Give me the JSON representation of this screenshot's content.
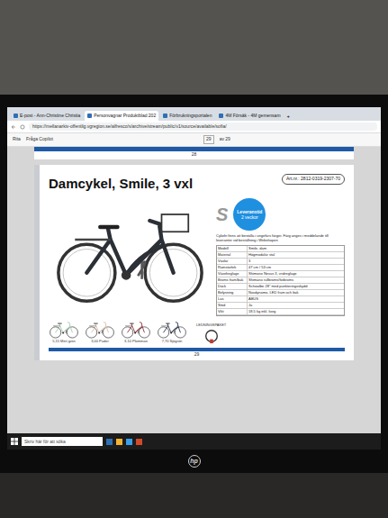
{
  "browser": {
    "tabs": [
      {
        "label": "E-post - Ann-Christine Christia",
        "selected": false
      },
      {
        "label": "Personvagnar Produktblad 202",
        "selected": true
      },
      {
        "label": "Förbrukningsportalen",
        "selected": false
      },
      {
        "label": "4M Försäk - 4M gemensam",
        "selected": false
      }
    ],
    "new_tab": "+",
    "address": "https://mellanarkiv-offentlig.vgregion.se/alfresco/s/archive/stream/public/v1/source/available/sofia/"
  },
  "pdf_toolbar": {
    "draw": "Rita",
    "copilot": "Fråga Copilot",
    "page": "29",
    "of": "av 29"
  },
  "previous_page": {
    "number": "28"
  },
  "page": {
    "title": "Damcykel, Smile, 3 vxl",
    "article": "Art.nr.: 2812-0319-2307-70",
    "brand_letter": "S",
    "delivery": {
      "label": "Leveranstid",
      "value": "2 veckor"
    },
    "description": "Cykeln finns att beställa i ungefärs färger. Färg anges i meddelande till leverantör vid beställning i Webshopen",
    "specs": [
      {
        "label": "Modell",
        "value": "Smile, dam"
      },
      {
        "label": "Material",
        "value": "Högmodulär stål"
      },
      {
        "label": "Växlar",
        "value": "3"
      },
      {
        "label": "Ramstorlek",
        "value": "47 cm / 53 cm"
      },
      {
        "label": "Växelreglage",
        "value": "Shimano Nexus 3, vridreglage"
      },
      {
        "label": "Broms fram/bak",
        "value": "Shimano rullbroms/fotbroms"
      },
      {
        "label": "Däck",
        "value": "Schwalbe 28\" med punkteringsskydd"
      },
      {
        "label": "Belysning",
        "value": "Navdynamo, LED fram och bak"
      },
      {
        "label": "Lås",
        "value": "ABUS"
      },
      {
        "label": "Stöd",
        "value": "Ja"
      },
      {
        "label": "Vikt",
        "value": "18,5 kg inkl. korg"
      }
    ],
    "colors": [
      {
        "label": "5,15 Mint grön",
        "color": "#9fc9b0"
      },
      {
        "label": "3,00 Puder",
        "color": "#dcb8a8"
      },
      {
        "label": "3,10 Plommon",
        "color": "#8e2a35"
      },
      {
        "label": "7,70 Sjögrön",
        "color": "#1f2a44"
      }
    ],
    "lock_label": "LEDNINGSPAKET",
    "number": "29"
  },
  "taskbar": {
    "search": "Skriv här för att söka"
  },
  "monitor": {
    "logo": "hp"
  }
}
